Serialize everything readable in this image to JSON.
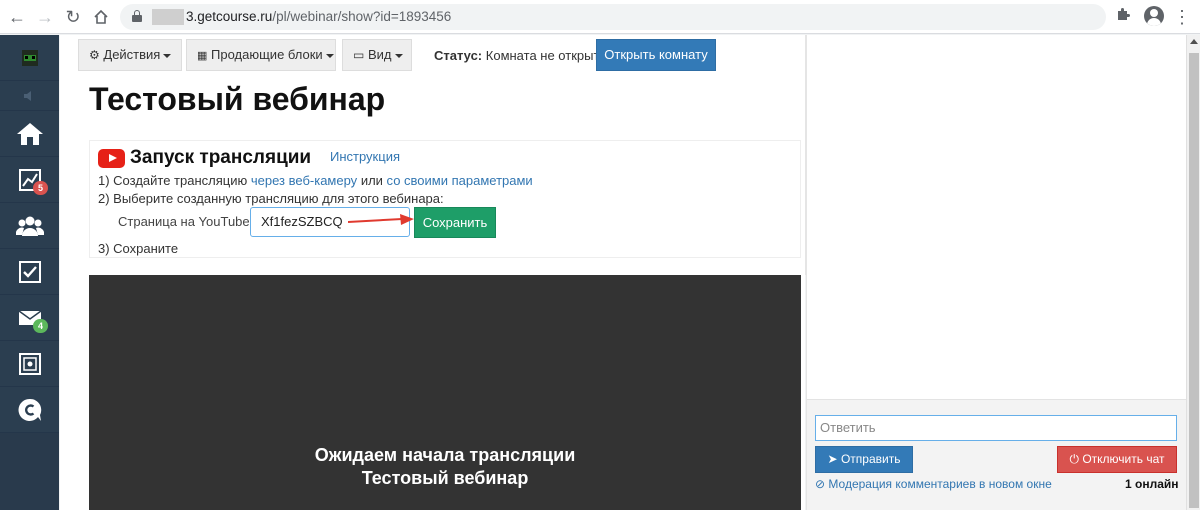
{
  "browser": {
    "url_domain": "3.getcourse.ru",
    "url_path": "/pl/webinar/show?id=1893456"
  },
  "sidebar": {
    "badges": {
      "stats": "5",
      "mail": "4"
    }
  },
  "toolbar": {
    "actions_label": "Действия",
    "blocks_label": "Продающие блоки",
    "view_label": "Вид",
    "status_label": "Статус:",
    "status_value": "Комната не открыта",
    "open_room_label": "Открыть комнату"
  },
  "page": {
    "title": "Тестовый вебинар"
  },
  "broadcast": {
    "title": "Запуск трансляции",
    "instruction_link": "Инструкция",
    "step1_prefix": "1) Создайте трансляцию",
    "step1_link1": "через веб-камеру",
    "step1_mid": "или",
    "step1_link2": "со своими параметрами",
    "step2": "2) Выберите созданную трансляцию для этого вебинара:",
    "youtube_label": "Страница на YouTube:",
    "youtube_value": "Xf1fezSZBCQ",
    "save_label": "Сохранить",
    "step3": "3) Сохраните"
  },
  "video": {
    "line1": "Ожидаем начала трансляции",
    "line2": "Тестовый вебинар"
  },
  "chat": {
    "reply_placeholder": "Ответить",
    "send_label": "Отправить",
    "disable_label": "Отключить чат",
    "moderation_link": "Модерация комментариев в новом окне",
    "online_count": "1 онлайн"
  },
  "colors": {
    "sidebar": "#2b3e50",
    "primary": "#337ab7",
    "success": "#1e9e68",
    "danger": "#d9534f",
    "link": "#3276b1"
  }
}
